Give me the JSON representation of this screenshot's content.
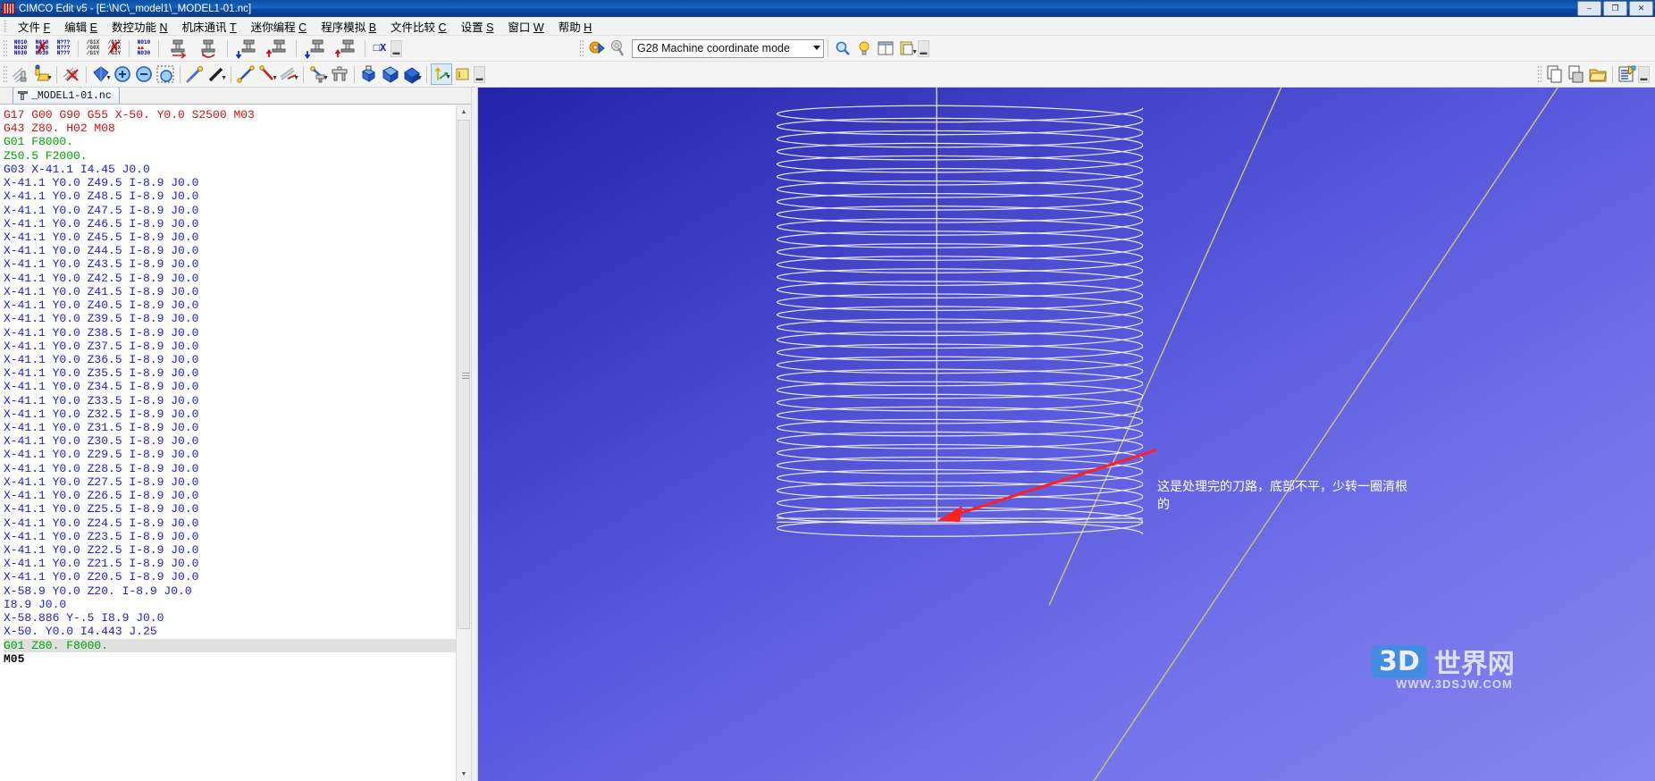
{
  "window": {
    "title": "CIMCO Edit v5 - [E:\\NC\\_model1\\_MODEL1-01.nc]",
    "icon": "app-icon",
    "buttons": [
      {
        "name": "minimize",
        "glyph": "–"
      },
      {
        "name": "maximize",
        "glyph": "❐"
      },
      {
        "name": "close",
        "glyph": "✕"
      }
    ]
  },
  "menu": [
    {
      "label": "文件",
      "accel": "F"
    },
    {
      "label": "编辑",
      "accel": "E"
    },
    {
      "label": "数控功能",
      "accel": "N"
    },
    {
      "label": "机床通讯",
      "accel": "T"
    },
    {
      "label": "迷你编程",
      "accel": "C"
    },
    {
      "label": "程序模拟",
      "accel": "B"
    },
    {
      "label": "文件比较",
      "accel": "C"
    },
    {
      "label": "设置",
      "accel": "S"
    },
    {
      "label": "窗口",
      "accel": "W"
    },
    {
      "label": "帮助",
      "accel": "H"
    }
  ],
  "toolbar_top": {
    "items": [
      {
        "name": "renumber-nc-blocks-button",
        "kind": "nc",
        "text": "N010\nN020\nN030"
      },
      {
        "name": "remove-nc-numbers-button",
        "kind": "nc-x",
        "text": "N010\nN020\nN030"
      },
      {
        "name": "renumber-question-button",
        "kind": "nc",
        "text": "N???\nN???\nN???"
      },
      {
        "name": "insert-gcode-button",
        "kind": "slash",
        "text": "/G1X\n/G0X\n/G1Y"
      },
      {
        "name": "remove-gcode-button",
        "kind": "slash-x",
        "text": "/G1X\n/G0X\n/G1Y"
      },
      {
        "name": "block-spacing-button",
        "kind": "nc-arrows",
        "text": "N010\n↑↑\nN030"
      },
      {
        "name": "tool-compensation-right-button",
        "kind": "tool-arrow-right"
      },
      {
        "name": "tool-compensation-arc-button",
        "kind": "tool-arc"
      },
      {
        "name": "tool-down-button",
        "kind": "tool-down"
      },
      {
        "name": "tool-up-button",
        "kind": "tool-up"
      },
      {
        "name": "tool-down-2-button",
        "kind": "tool-down"
      },
      {
        "name": "tool-up-2-button",
        "kind": "tool-up"
      },
      {
        "name": "clear-x-button",
        "kind": "ox"
      }
    ],
    "mode_combo": {
      "value": "G28 Machine coordinate mode",
      "name": "machine-coordinate-mode-select"
    },
    "right_items": [
      {
        "name": "find-icon",
        "kind": "magnifier"
      },
      {
        "name": "hint-bulb-icon",
        "kind": "bulb"
      },
      {
        "name": "split-view-icon",
        "kind": "split"
      },
      {
        "name": "copy-to-clipboard-icon",
        "kind": "clipboard"
      }
    ]
  },
  "toolbar_second": {
    "left_items": [
      {
        "name": "toolpath-hide-icon",
        "kind": "path-hide"
      },
      {
        "name": "toolpath-open-icon",
        "kind": "path-open"
      },
      {
        "name": "toolpath-delete-icon",
        "kind": "path-delete"
      },
      {
        "name": "solid-view-icon",
        "kind": "solid"
      },
      {
        "name": "zoom-in-icon",
        "kind": "zoom-in"
      },
      {
        "name": "zoom-out-icon",
        "kind": "zoom-out"
      },
      {
        "name": "zoom-window-icon",
        "kind": "zoom-window"
      },
      {
        "name": "measure-pick-icon",
        "kind": "pick"
      },
      {
        "name": "measure-line-icon",
        "kind": "line"
      },
      {
        "name": "measure-line2-icon",
        "kind": "line2"
      },
      {
        "name": "measure-diagonal-icon",
        "kind": "diag"
      },
      {
        "name": "measure-radius-icon",
        "kind": "radius"
      },
      {
        "name": "measure-angle-icon",
        "kind": "angle"
      },
      {
        "name": "probe-icon",
        "kind": "probe"
      },
      {
        "name": "table-setup-icon",
        "kind": "table"
      },
      {
        "name": "view-iso-icon",
        "kind": "iso1"
      },
      {
        "name": "view-iso2-icon",
        "kind": "iso2"
      },
      {
        "name": "view-iso3-icon",
        "kind": "iso3"
      },
      {
        "name": "axis-orient-icon",
        "kind": "axis"
      },
      {
        "name": "axis-orient2-icon",
        "kind": "axis2"
      }
    ],
    "right_items": [
      {
        "name": "copy-page-icon",
        "kind": "page-copy"
      },
      {
        "name": "paste-page-icon",
        "kind": "page-paste"
      },
      {
        "name": "open-folder-icon",
        "kind": "folder"
      },
      {
        "name": "edit-properties-icon",
        "kind": "props"
      }
    ]
  },
  "editor": {
    "tab": {
      "label": "_MODEL1-01.nc",
      "icon": "nc-file-icon"
    },
    "lines": [
      {
        "t": "G17 G00 G90 G55 X-50. Y0.0 S2500 M03",
        "c": "red"
      },
      {
        "t": "G43 Z80. H02 M08",
        "c": "red"
      },
      {
        "t": "G01 F8000.",
        "c": "green"
      },
      {
        "t": "Z50.5 F2000.",
        "c": "green"
      },
      {
        "t": "G03 X-41.1 I4.45 J0.0",
        "c": "blue"
      },
      {
        "t": "X-41.1 Y0.0 Z49.5 I-8.9 J0.0",
        "c": "blue"
      },
      {
        "t": "X-41.1 Y0.0 Z48.5 I-8.9 J0.0",
        "c": "blue"
      },
      {
        "t": "X-41.1 Y0.0 Z47.5 I-8.9 J0.0",
        "c": "blue"
      },
      {
        "t": "X-41.1 Y0.0 Z46.5 I-8.9 J0.0",
        "c": "blue"
      },
      {
        "t": "X-41.1 Y0.0 Z45.5 I-8.9 J0.0",
        "c": "blue"
      },
      {
        "t": "X-41.1 Y0.0 Z44.5 I-8.9 J0.0",
        "c": "blue"
      },
      {
        "t": "X-41.1 Y0.0 Z43.5 I-8.9 J0.0",
        "c": "blue"
      },
      {
        "t": "X-41.1 Y0.0 Z42.5 I-8.9 J0.0",
        "c": "blue"
      },
      {
        "t": "X-41.1 Y0.0 Z41.5 I-8.9 J0.0",
        "c": "blue"
      },
      {
        "t": "X-41.1 Y0.0 Z40.5 I-8.9 J0.0",
        "c": "blue"
      },
      {
        "t": "X-41.1 Y0.0 Z39.5 I-8.9 J0.0",
        "c": "blue"
      },
      {
        "t": "X-41.1 Y0.0 Z38.5 I-8.9 J0.0",
        "c": "blue"
      },
      {
        "t": "X-41.1 Y0.0 Z37.5 I-8.9 J0.0",
        "c": "blue"
      },
      {
        "t": "X-41.1 Y0.0 Z36.5 I-8.9 J0.0",
        "c": "blue"
      },
      {
        "t": "X-41.1 Y0.0 Z35.5 I-8.9 J0.0",
        "c": "blue"
      },
      {
        "t": "X-41.1 Y0.0 Z34.5 I-8.9 J0.0",
        "c": "blue"
      },
      {
        "t": "X-41.1 Y0.0 Z33.5 I-8.9 J0.0",
        "c": "blue"
      },
      {
        "t": "X-41.1 Y0.0 Z32.5 I-8.9 J0.0",
        "c": "blue"
      },
      {
        "t": "X-41.1 Y0.0 Z31.5 I-8.9 J0.0",
        "c": "blue"
      },
      {
        "t": "X-41.1 Y0.0 Z30.5 I-8.9 J0.0",
        "c": "blue"
      },
      {
        "t": "X-41.1 Y0.0 Z29.5 I-8.9 J0.0",
        "c": "blue"
      },
      {
        "t": "X-41.1 Y0.0 Z28.5 I-8.9 J0.0",
        "c": "blue"
      },
      {
        "t": "X-41.1 Y0.0 Z27.5 I-8.9 J0.0",
        "c": "blue"
      },
      {
        "t": "X-41.1 Y0.0 Z26.5 I-8.9 J0.0",
        "c": "blue"
      },
      {
        "t": "X-41.1 Y0.0 Z25.5 I-8.9 J0.0",
        "c": "blue"
      },
      {
        "t": "X-41.1 Y0.0 Z24.5 I-8.9 J0.0",
        "c": "blue"
      },
      {
        "t": "X-41.1 Y0.0 Z23.5 I-8.9 J0.0",
        "c": "blue"
      },
      {
        "t": "X-41.1 Y0.0 Z22.5 I-8.9 J0.0",
        "c": "blue"
      },
      {
        "t": "X-41.1 Y0.0 Z21.5 I-8.9 J0.0",
        "c": "blue"
      },
      {
        "t": "X-41.1 Y0.0 Z20.5 I-8.9 J0.0",
        "c": "blue"
      },
      {
        "t": "X-58.9 Y0.0 Z20. I-8.9 J0.0",
        "c": "blue"
      },
      {
        "t": "I8.9 J0.0",
        "c": "blue"
      },
      {
        "t": "X-58.886 Y-.5 I8.9 J0.0",
        "c": "blue"
      },
      {
        "t": "X-50. Y0.0 I4.443 J.25",
        "c": "blue"
      },
      {
        "t": "G01 Z80. F8000.",
        "c": "green",
        "hl": true
      },
      {
        "t": "M05",
        "c": "black"
      }
    ]
  },
  "view3d": {
    "annotation": "这是处理完的刀路，底部不平，少转一圈清根的",
    "watermark": {
      "badge": "3D",
      "text": "世界网",
      "url": "WWW.3DSJW.COM"
    },
    "colors": {
      "toolpath": "#e6e6ef",
      "arrow": "#ff2020",
      "axis": "#c9c96a",
      "bg_top": "#2323a8",
      "bg_bottom": "#8585ef"
    }
  }
}
